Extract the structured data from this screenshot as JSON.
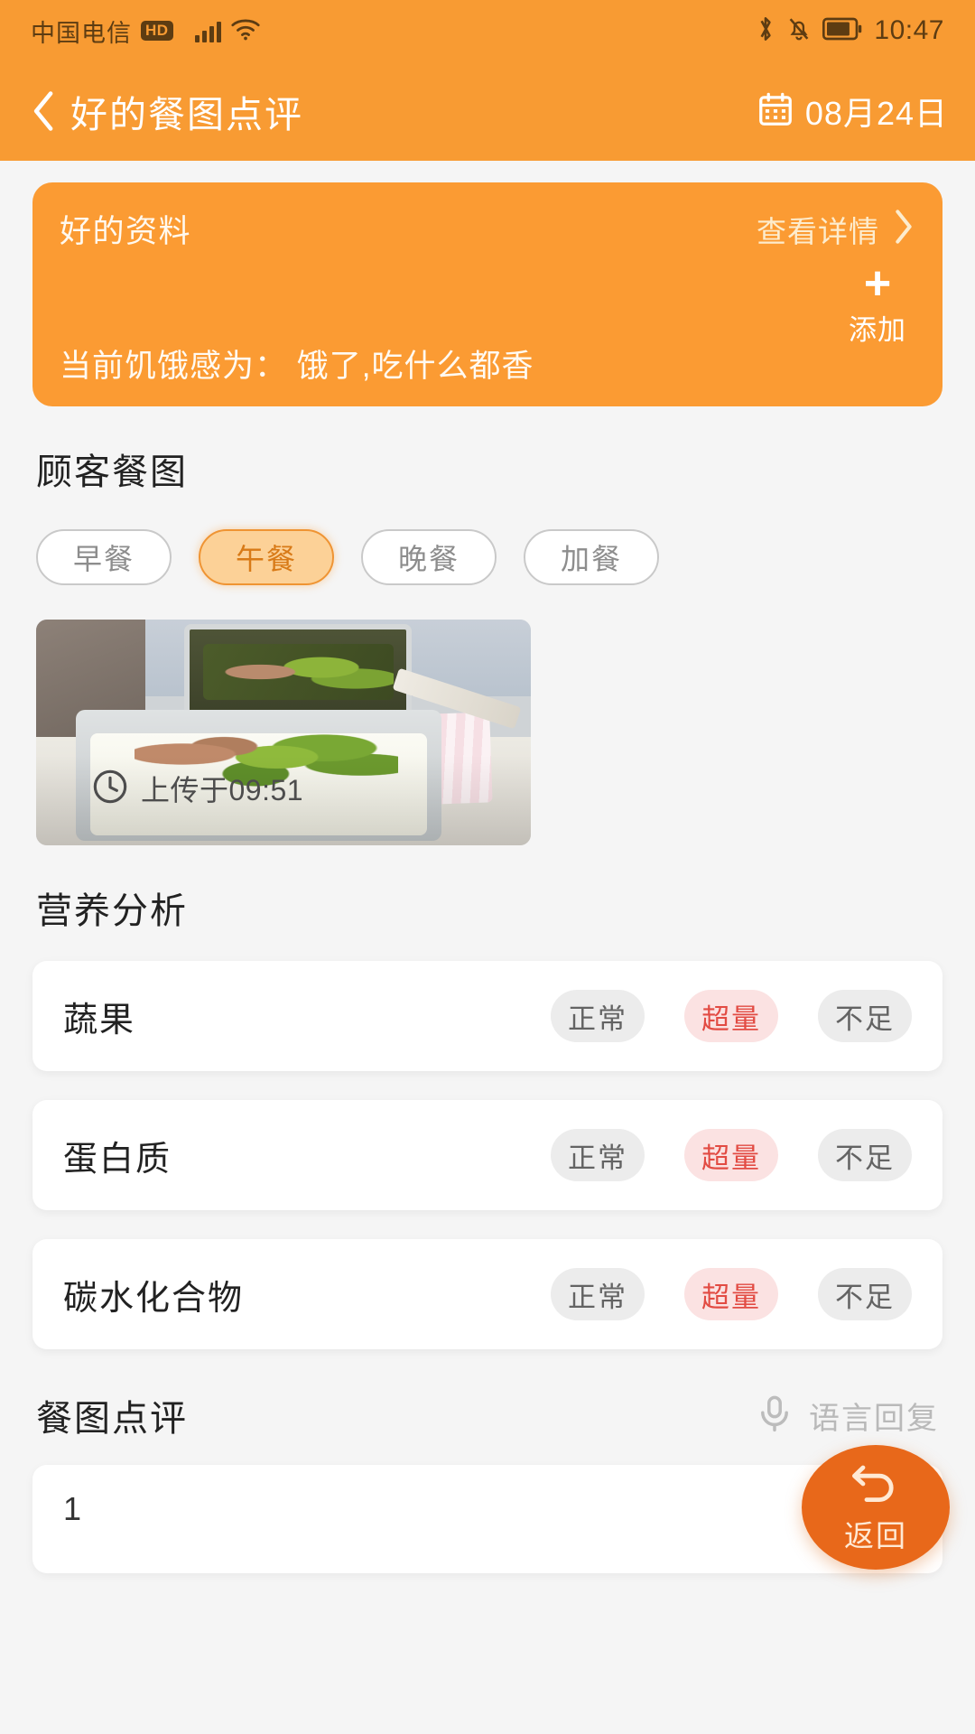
{
  "statusbar": {
    "carrier": "中国电信",
    "hd_badge": "HD",
    "time": "10:47",
    "icons": [
      "signal-bars-icon",
      "wifi-icon",
      "bluetooth-icon",
      "bell-muted-icon",
      "battery-icon"
    ]
  },
  "header": {
    "title": "好的餐图点评",
    "back_icon": "back-chevron-icon",
    "date": "08月24日",
    "calendar_icon": "calendar-icon"
  },
  "info_card": {
    "title": "好的资料",
    "detail_link": "查看详情",
    "detail_chevron": "chevron-right-icon",
    "add_plus": "+",
    "add_label": "添加",
    "hunger_text": "当前饥饿感为： 饿了,吃什么都香",
    "bg_color": "#fb9b33"
  },
  "meal_section": {
    "title": "顾客餐图",
    "tabs": [
      {
        "label": "早餐",
        "active": false
      },
      {
        "label": "午餐",
        "active": true
      },
      {
        "label": "晚餐",
        "active": false
      },
      {
        "label": "加餐",
        "active": false
      }
    ],
    "photo": {
      "clock_icon": "clock-icon",
      "upload_text": "上传于09:51",
      "alt": "lunch-tray-rice-peppers-sausage"
    }
  },
  "nutrition": {
    "title": "营养分析",
    "rows": [
      {
        "name": "蔬果",
        "chips": [
          {
            "label": "正常",
            "state": "neutral"
          },
          {
            "label": "超量",
            "state": "over"
          },
          {
            "label": "不足",
            "state": "neutral"
          }
        ]
      },
      {
        "name": "蛋白质",
        "chips": [
          {
            "label": "正常",
            "state": "neutral"
          },
          {
            "label": "超量",
            "state": "over"
          },
          {
            "label": "不足",
            "state": "neutral"
          }
        ]
      },
      {
        "name": "碳水化合物",
        "chips": [
          {
            "label": "正常",
            "state": "neutral"
          },
          {
            "label": "超量",
            "state": "over"
          },
          {
            "label": "不足",
            "state": "neutral"
          }
        ]
      }
    ],
    "chip_neutral_color": "#ececec",
    "chip_over_color": "#fbe2e2",
    "chip_over_text_color": "#e24b43"
  },
  "comment": {
    "title": "餐图点评",
    "voice_icon": "microphone-icon",
    "voice_label": "语言回复",
    "input_value": "1",
    "input_placeholder": ""
  },
  "fab": {
    "icon": "undo-arrow-icon",
    "label": "返回",
    "color": "#e8681a"
  }
}
